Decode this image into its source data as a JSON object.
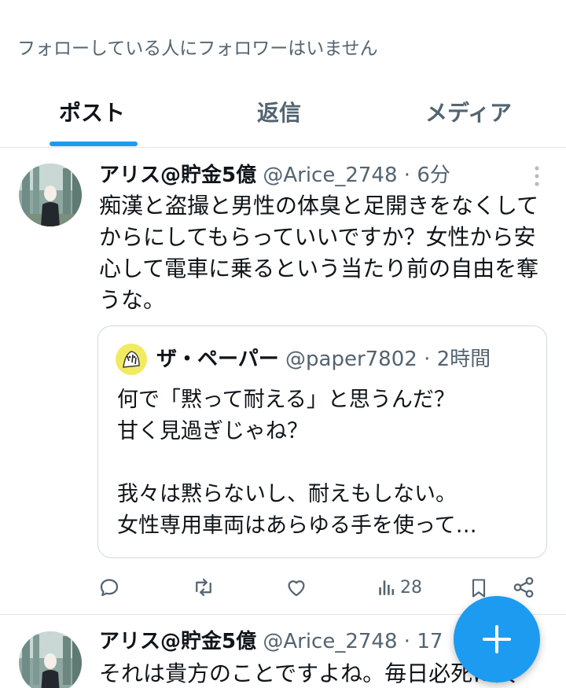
{
  "header": {
    "followers_note": "フォローしている人にフォロワーはいません"
  },
  "tabs": [
    {
      "label": "ポスト",
      "active": true
    },
    {
      "label": "返信",
      "active": false
    },
    {
      "label": "メディア",
      "active": false
    }
  ],
  "colors": {
    "accent": "#1d9bf0",
    "text_primary": "#0f1419",
    "text_secondary": "#536471",
    "border": "#e1e6ea"
  },
  "posts": [
    {
      "name": "アリス@貯金5億",
      "handle": "@Arice_2748",
      "separator": "·",
      "time": "6分",
      "text": "痴漢と盗撮と男性の体臭と足開きをなくしてからにしてもらっていいですか？女性から安心して電車に乗るという当たり前の自由を奪うな。",
      "quote": {
        "name": "ザ・ペーパー",
        "handle": "@paper7802",
        "separator": "·",
        "time": "2時間",
        "lines": [
          "何で「黙って耐える」と思うんだ？",
          "甘く見過ぎじゃね？",
          "",
          "我々は黙らないし、耐えもしない。",
          "女性専用車両はあらゆる手を使って…"
        ]
      },
      "actions": {
        "reply_icon": "reply-icon",
        "repost_icon": "repost-icon",
        "like_icon": "like-icon",
        "views_icon": "views-icon",
        "views_count": "28",
        "bookmark_icon": "bookmark-icon",
        "share_icon": "share-icon"
      }
    },
    {
      "name": "アリス@貯金5億",
      "handle": "@Arice_2748",
      "separator": "·",
      "time": "17",
      "text": "それは貴方のことですよね。毎日必死に女"
    }
  ],
  "fab": {
    "icon": "plus-icon"
  }
}
